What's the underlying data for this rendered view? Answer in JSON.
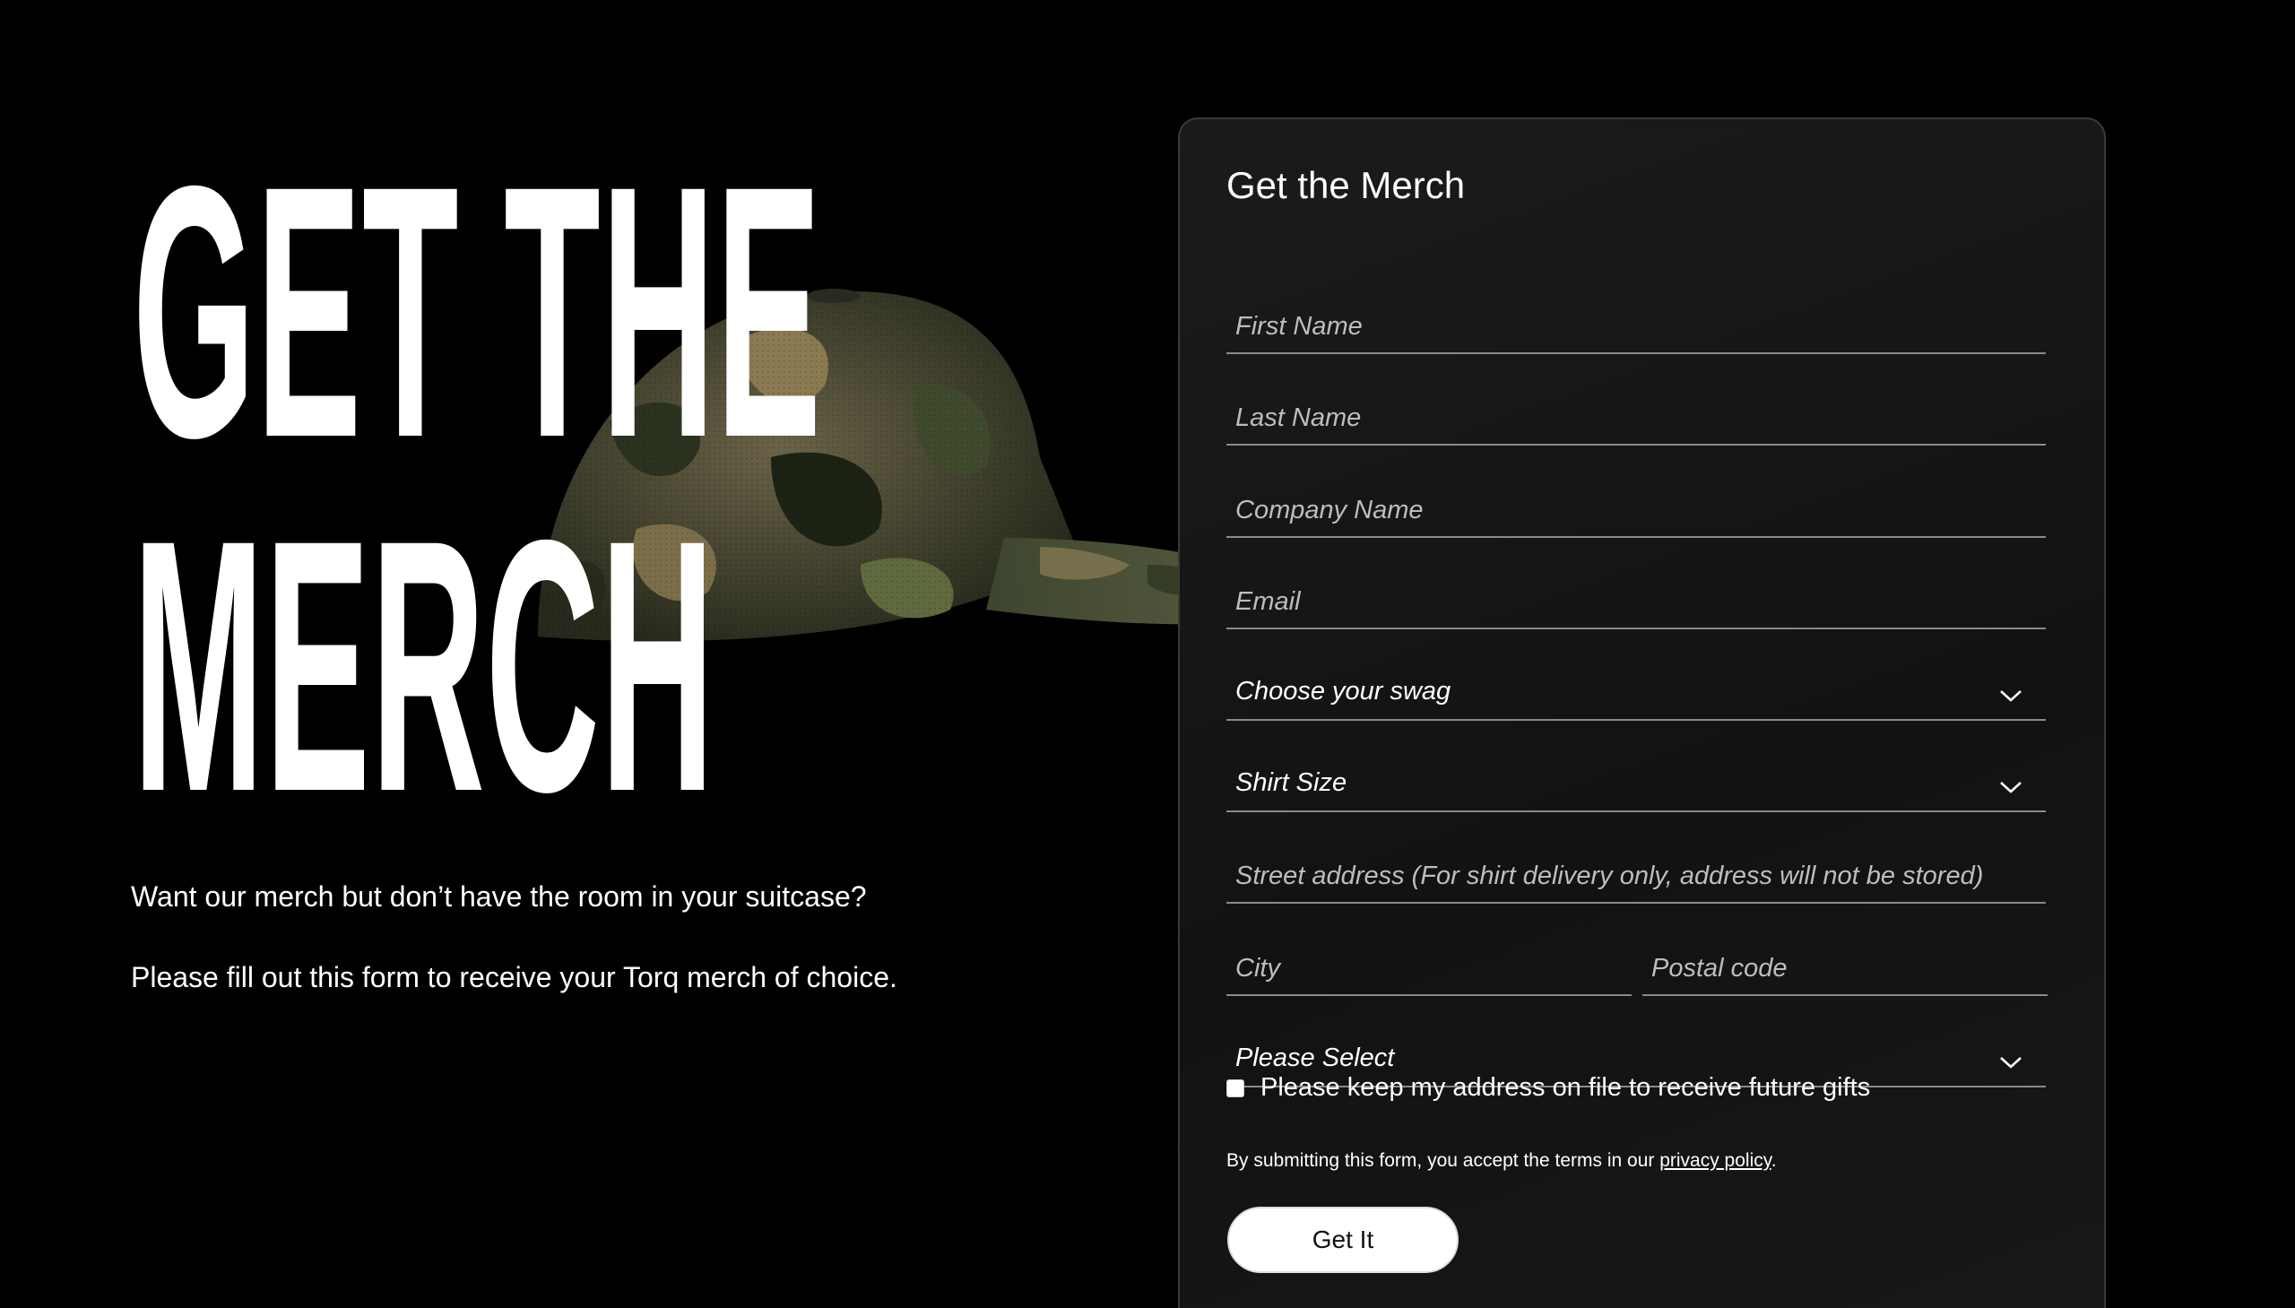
{
  "hero": {
    "line1": "GET THE",
    "line2": "MERCH",
    "paragraph1": "Want our merch but don’t have the room in your suitcase?",
    "paragraph2": "Please fill out this form to receive your Torq merch of choice."
  },
  "form": {
    "title": "Get the Merch",
    "first_name_placeholder": "First Name",
    "last_name_placeholder": "Last Name",
    "company_placeholder": "Company Name",
    "email_placeholder": "Email",
    "swag_select": "Choose your swag",
    "shirt_size_select": "Shirt Size",
    "street_placeholder": "Street address (For shirt delivery only, address will not be stored)",
    "city_placeholder": "City",
    "postal_placeholder": "Postal code",
    "country_select": "Please Select",
    "checkbox_label": "Please keep my address on file to receive future gifts",
    "legal_prefix": "By submitting this form, you accept the terms in our ",
    "legal_link": "privacy policy",
    "legal_suffix": ".",
    "submit_label": "Get It"
  },
  "colors": {
    "background": "#000000",
    "card": "#161616",
    "text": "#ffffff",
    "underline": "#8a8a8a"
  },
  "icons": [
    "chevron-down-icon",
    "camo-cap-image"
  ]
}
